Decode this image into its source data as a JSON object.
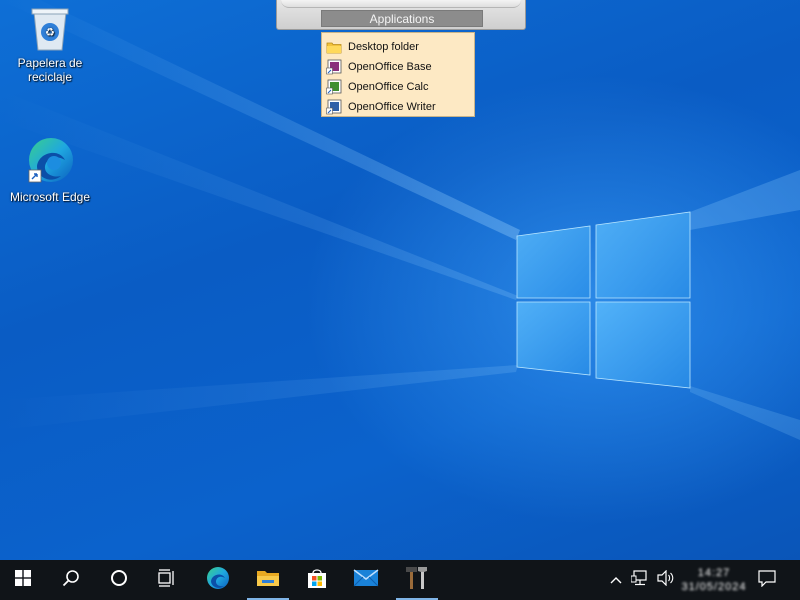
{
  "desktop": {
    "icons": [
      {
        "label": "Papelera de reciclaje",
        "icon": "recycle-bin-icon"
      },
      {
        "label": "Microsoft Edge",
        "icon": "edge-icon"
      }
    ]
  },
  "launcher": {
    "button_label": "Applications",
    "menu_items": [
      {
        "label": "Desktop folder",
        "icon": "folder-icon"
      },
      {
        "label": "OpenOffice Base",
        "icon": "openoffice-base-icon"
      },
      {
        "label": "OpenOffice Calc",
        "icon": "openoffice-calc-icon"
      },
      {
        "label": "OpenOffice Writer",
        "icon": "openoffice-writer-icon"
      }
    ]
  },
  "taskbar": {
    "buttons": [
      {
        "name": "start-button",
        "icon": "windows-logo-icon"
      },
      {
        "name": "search-button",
        "icon": "search-icon"
      },
      {
        "name": "cortana-button",
        "icon": "circle-icon"
      },
      {
        "name": "task-view-button",
        "icon": "task-view-icon"
      },
      {
        "name": "edge-taskbar-button",
        "icon": "edge-icon"
      },
      {
        "name": "file-explorer-button",
        "icon": "folder-icon"
      },
      {
        "name": "store-button",
        "icon": "store-icon"
      },
      {
        "name": "mail-button",
        "icon": "mail-icon"
      },
      {
        "name": "tools-button",
        "icon": "tools-icon"
      }
    ],
    "tray": {
      "icons": [
        "chevron-up-icon",
        "network-icon",
        "volume-icon",
        "notification-icon"
      ],
      "clock": {
        "time": "14:27",
        "date": "31/05/2024"
      }
    }
  },
  "colors": {
    "taskbar_bg": "#101418",
    "menu_bg": "#fde9c4",
    "launcher_button_bg": "#8c8c8c",
    "accent": "#0078d7"
  }
}
